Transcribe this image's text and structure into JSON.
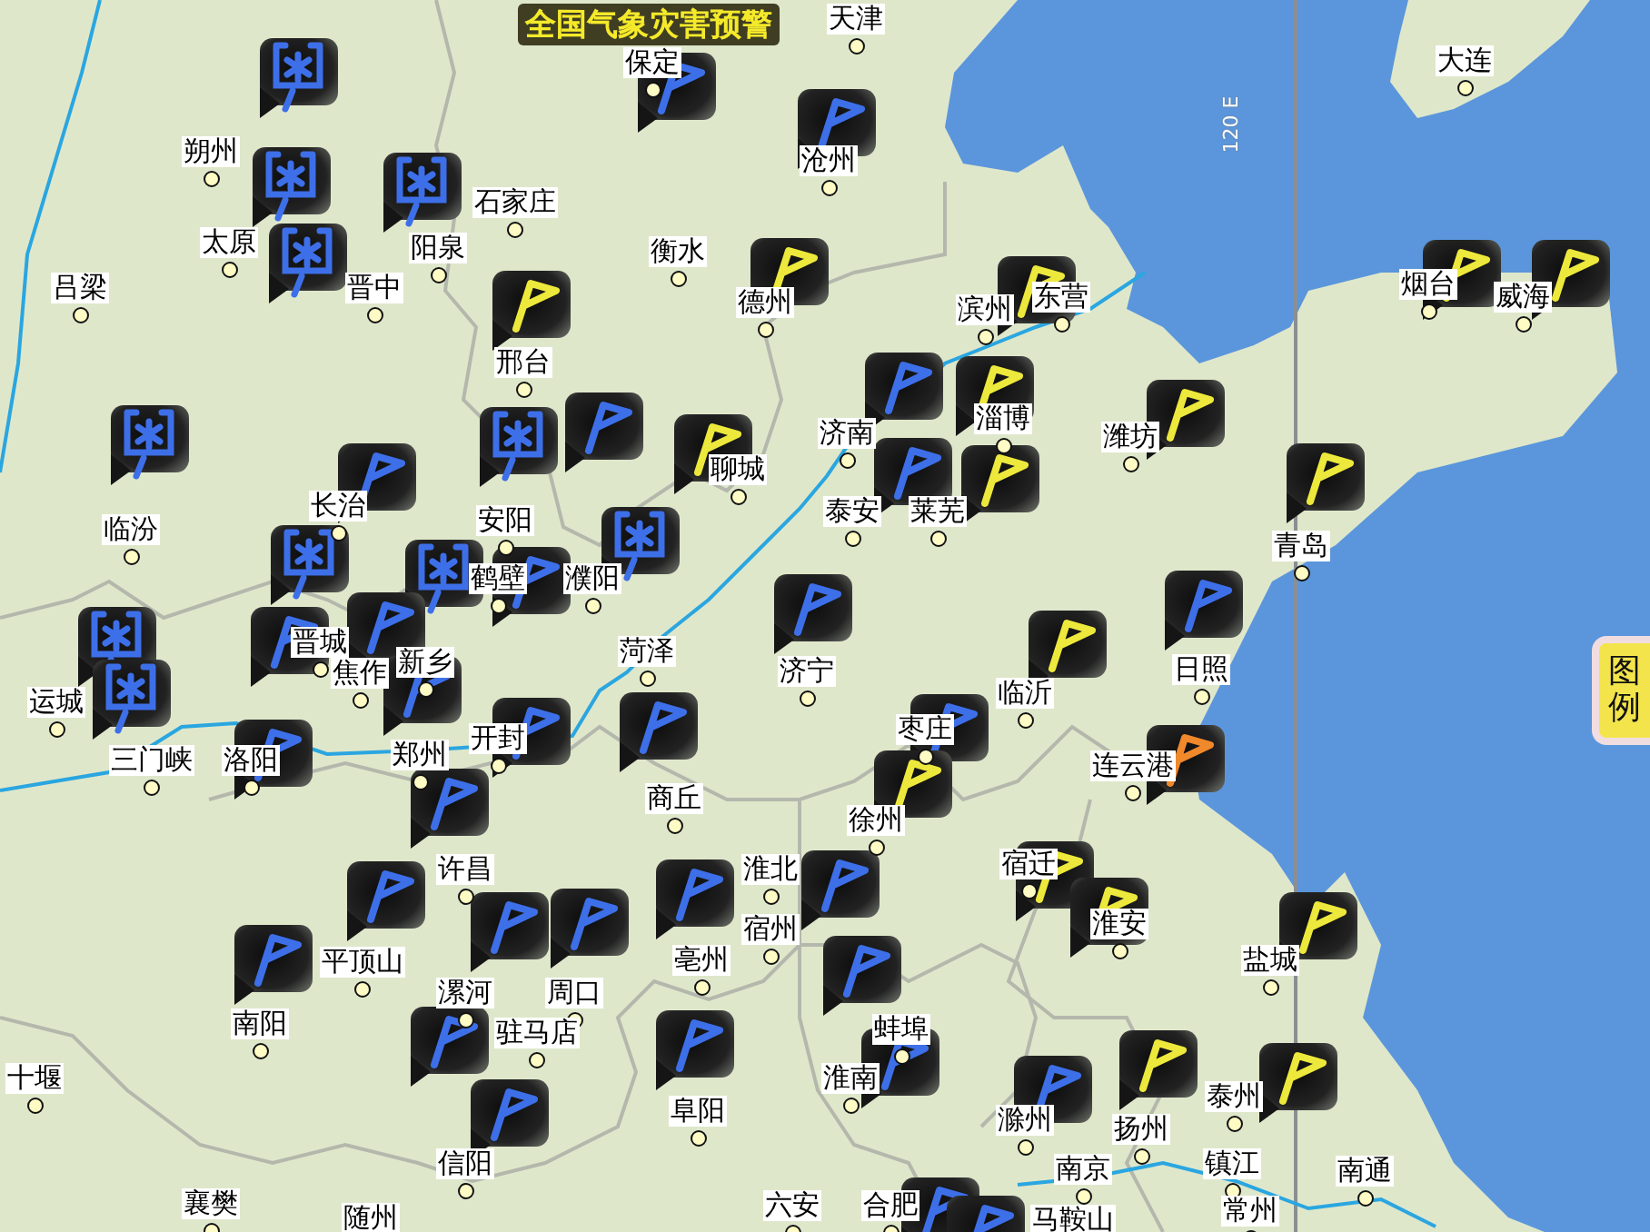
{
  "title": "全国气象灾害预警",
  "meridian_label": "120 E",
  "legend_button": "图例",
  "cities": [
    {
      "name": "天津"
    },
    {
      "name": "保定"
    },
    {
      "name": "大连"
    },
    {
      "name": "朔州"
    },
    {
      "name": "沧州"
    },
    {
      "name": "石家庄"
    },
    {
      "name": "太原"
    },
    {
      "name": "阳泉"
    },
    {
      "name": "衡水"
    },
    {
      "name": "吕梁"
    },
    {
      "name": "晋中"
    },
    {
      "name": "德州"
    },
    {
      "name": "滨州"
    },
    {
      "name": "东营"
    },
    {
      "name": "烟台"
    },
    {
      "name": "威海"
    },
    {
      "name": "邢台"
    },
    {
      "name": "济南"
    },
    {
      "name": "淄博"
    },
    {
      "name": "潍坊"
    },
    {
      "name": "聊城"
    },
    {
      "name": "临汾"
    },
    {
      "name": "长治"
    },
    {
      "name": "安阳"
    },
    {
      "name": "泰安"
    },
    {
      "name": "莱芜"
    },
    {
      "name": "青岛"
    },
    {
      "name": "鹤壁"
    },
    {
      "name": "濮阳"
    },
    {
      "name": "运城"
    },
    {
      "name": "晋城"
    },
    {
      "name": "焦作"
    },
    {
      "name": "新乡"
    },
    {
      "name": "菏泽"
    },
    {
      "name": "济宁"
    },
    {
      "name": "临沂"
    },
    {
      "name": "日照"
    },
    {
      "name": "三门峡"
    },
    {
      "name": "洛阳"
    },
    {
      "name": "郑州"
    },
    {
      "name": "开封"
    },
    {
      "name": "枣庄"
    },
    {
      "name": "连云港"
    },
    {
      "name": "商丘"
    },
    {
      "name": "徐州"
    },
    {
      "name": "许昌"
    },
    {
      "name": "淮北"
    },
    {
      "name": "宿迁"
    },
    {
      "name": "宿州"
    },
    {
      "name": "淮安"
    },
    {
      "name": "平顶山"
    },
    {
      "name": "亳州"
    },
    {
      "name": "盐城"
    },
    {
      "name": "漯河"
    },
    {
      "name": "周口"
    },
    {
      "name": "南阳"
    },
    {
      "name": "驻马店"
    },
    {
      "name": "蚌埠"
    },
    {
      "name": "十堰"
    },
    {
      "name": "淮南"
    },
    {
      "name": "阜阳"
    },
    {
      "name": "滁州"
    },
    {
      "name": "泰州"
    },
    {
      "name": "扬州"
    },
    {
      "name": "信阳"
    },
    {
      "name": "南京"
    },
    {
      "name": "镇江"
    },
    {
      "name": "南通"
    },
    {
      "name": "襄樊"
    },
    {
      "name": "随州"
    },
    {
      "name": "六安"
    },
    {
      "name": "合肥"
    },
    {
      "name": "马鞍山"
    },
    {
      "name": "常州"
    }
  ],
  "warnings": [
    {
      "kind": "snow",
      "color": "#3d6fe8"
    },
    {
      "kind": "flag",
      "color": "#3d6fe8"
    },
    {
      "kind": "flag",
      "color": "#3d6fe8"
    },
    {
      "kind": "snow",
      "color": "#3d6fe8"
    },
    {
      "kind": "snow",
      "color": "#3d6fe8"
    },
    {
      "kind": "snow",
      "color": "#3d6fe8"
    },
    {
      "kind": "flag",
      "color": "#ede83c"
    },
    {
      "kind": "flag",
      "color": "#ede83c"
    },
    {
      "kind": "flag",
      "color": "#ede83c"
    },
    {
      "kind": "flag",
      "color": "#ede83c"
    },
    {
      "kind": "flag",
      "color": "#ede83c"
    },
    {
      "kind": "flag",
      "color": "#3d6fe8"
    },
    {
      "kind": "flag",
      "color": "#ede83c"
    },
    {
      "kind": "flag",
      "color": "#ede83c"
    },
    {
      "kind": "flag",
      "color": "#3d6fe8"
    },
    {
      "kind": "snow",
      "color": "#3d6fe8"
    },
    {
      "kind": "snow",
      "color": "#3d6fe8"
    },
    {
      "kind": "flag",
      "color": "#ede83c"
    },
    {
      "kind": "flag",
      "color": "#3d6fe8"
    },
    {
      "kind": "flag",
      "color": "#ede83c"
    },
    {
      "kind": "flag",
      "color": "#3d6fe8"
    },
    {
      "kind": "flag",
      "color": "#ede83c"
    },
    {
      "kind": "snow",
      "color": "#3d6fe8"
    },
    {
      "kind": "snow",
      "color": "#3d6fe8"
    },
    {
      "kind": "snow",
      "color": "#3d6fe8"
    },
    {
      "kind": "flag",
      "color": "#3d6fe8"
    },
    {
      "kind": "flag",
      "color": "#3d6fe8"
    },
    {
      "kind": "flag",
      "color": "#3d6fe8"
    },
    {
      "kind": "flag",
      "color": "#3d6fe8"
    },
    {
      "kind": "flag",
      "color": "#3d6fe8"
    },
    {
      "kind": "snow",
      "color": "#3d6fe8"
    },
    {
      "kind": "flag",
      "color": "#ede83c"
    },
    {
      "kind": "snow",
      "color": "#3d6fe8"
    },
    {
      "kind": "flag",
      "color": "#3d6fe8"
    },
    {
      "kind": "flag",
      "color": "#3d6fe8"
    },
    {
      "kind": "flag",
      "color": "#3d6fe8"
    },
    {
      "kind": "flag",
      "color": "#3d6fe8"
    },
    {
      "kind": "flag",
      "color": "#f0882c"
    },
    {
      "kind": "flag",
      "color": "#3d6fe8"
    },
    {
      "kind": "flag",
      "color": "#ede83c"
    },
    {
      "kind": "flag",
      "color": "#3d6fe8"
    },
    {
      "kind": "flag",
      "color": "#ede83c"
    },
    {
      "kind": "flag",
      "color": "#3d6fe8"
    },
    {
      "kind": "flag",
      "color": "#3d6fe8"
    },
    {
      "kind": "flag",
      "color": "#3d6fe8"
    },
    {
      "kind": "flag",
      "color": "#ede83c"
    },
    {
      "kind": "flag",
      "color": "#3d6fe8"
    },
    {
      "kind": "flag",
      "color": "#3d6fe8"
    },
    {
      "kind": "flag",
      "color": "#3d6fe8"
    },
    {
      "kind": "flag",
      "color": "#ede83c"
    },
    {
      "kind": "flag",
      "color": "#3d6fe8"
    },
    {
      "kind": "flag",
      "color": "#3d6fe8"
    },
    {
      "kind": "flag",
      "color": "#3d6fe8"
    },
    {
      "kind": "flag",
      "color": "#3d6fe8"
    },
    {
      "kind": "flag",
      "color": "#ede83c"
    },
    {
      "kind": "flag",
      "color": "#ede83c"
    },
    {
      "kind": "flag",
      "color": "#3d6fe8"
    },
    {
      "kind": "flag",
      "color": "#3d6fe8"
    },
    {
      "kind": "flag",
      "color": "#3d6fe8"
    },
    {
      "kind": "flag",
      "color": "#3d6fe8"
    }
  ]
}
